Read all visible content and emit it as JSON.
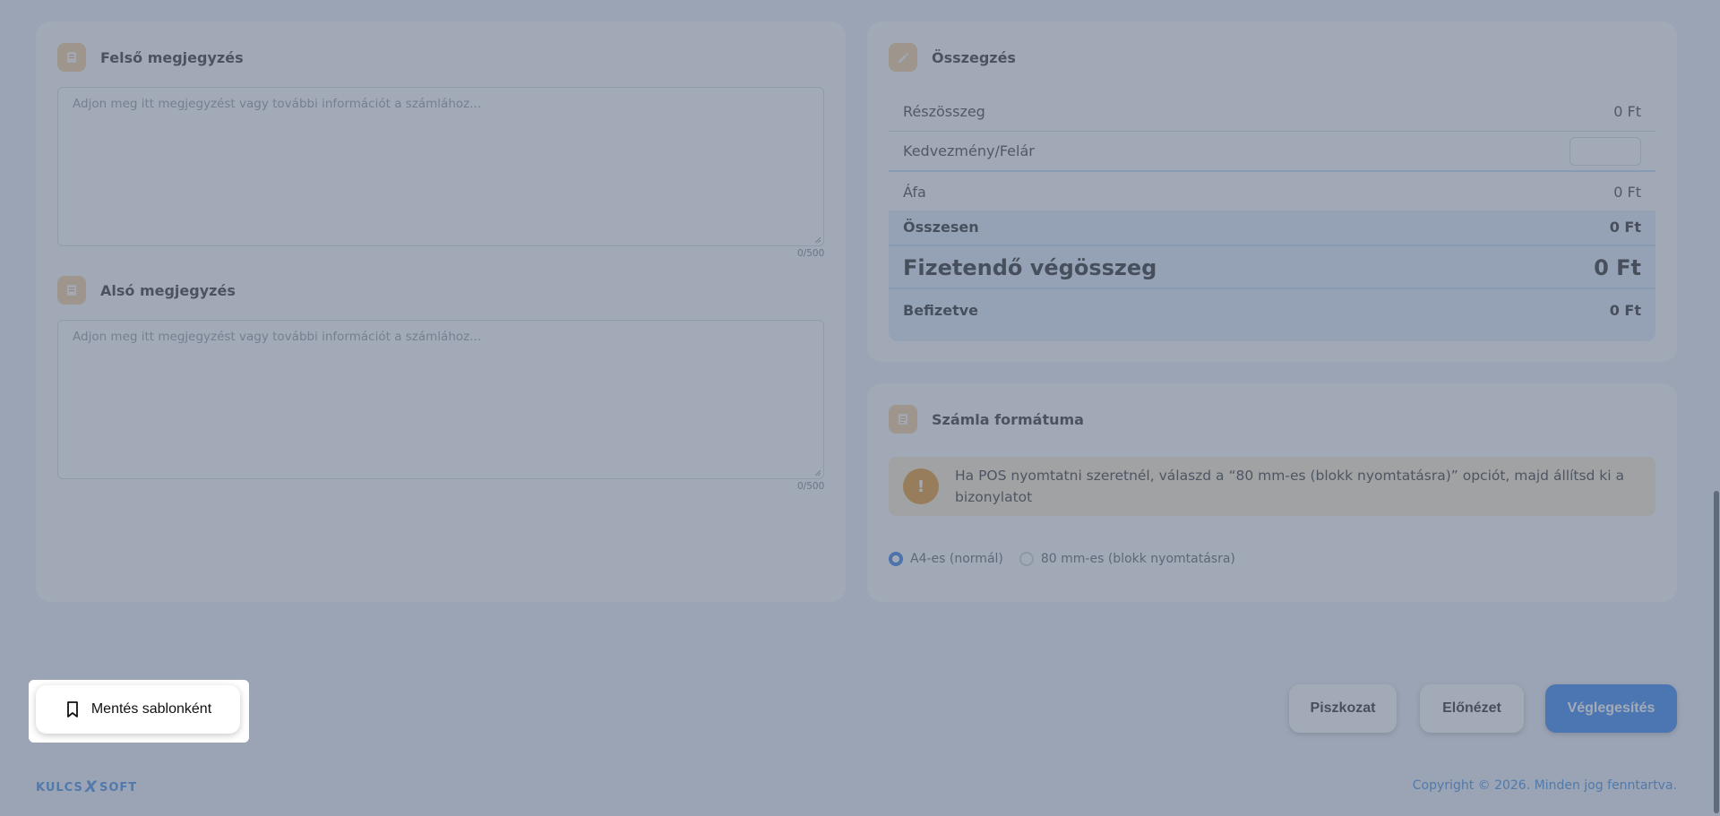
{
  "top_note": {
    "title": "Felső megjegyzés",
    "placeholder": "Adjon meg itt megjegyzést vagy további információt a számlához...",
    "count": "0/500",
    "icon": "note-icon"
  },
  "bottom_note": {
    "title": "Alsó megjegyzés",
    "placeholder": "Adjon meg itt megjegyzést vagy további információt a számlához...",
    "count": "0/500",
    "icon": "note-icon"
  },
  "summary": {
    "title": "Összegzés",
    "icon": "pencil-icon",
    "subtotal_label": "Részösszeg",
    "subtotal_value": "0 Ft",
    "discount_label": "Kedvezmény/Felár",
    "discount_value": "",
    "vat_label": "Áfa",
    "vat_value": "0 Ft",
    "total_label": "Összesen",
    "total_value": "0 Ft",
    "payable_label": "Fizetendő végösszeg",
    "payable_value": "0 Ft",
    "paid_label": "Befizetve",
    "paid_value": "0 Ft"
  },
  "format": {
    "title": "Számla formátuma",
    "icon": "document-icon",
    "warning": "Ha POS nyomtatni szeretnél, válaszd a “80 mm-es (blokk nyomtatásra)” opciót, majd állítsd ki a bizonylatot",
    "options": [
      "A4-es (normál)",
      "80 mm-es (blokk nyomtatásra)"
    ],
    "selected": "A4-es (normál)"
  },
  "actions": {
    "save_template": "Mentés sablonként",
    "draft": "Piszkozat",
    "preview": "Előnézet",
    "finalize": "Véglegesítés"
  },
  "footer": {
    "logo_left": "KULCS",
    "logo_mark": "X",
    "logo_right": "SOFT",
    "copyright": "Copyright © 2026. Minden jog fenntartva."
  },
  "colors": {
    "accent": "#1e78f0",
    "icon_bg": "#f3c98f",
    "warning_bg": "#fce9cd",
    "warning_icon": "#e48a12",
    "overlay": "#69768a"
  }
}
